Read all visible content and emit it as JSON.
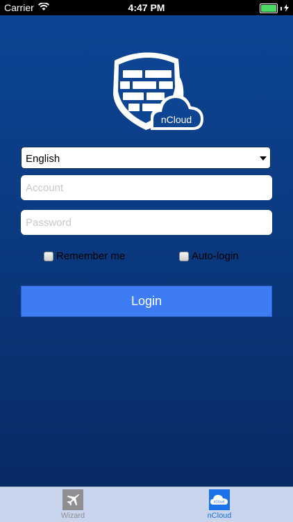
{
  "status": {
    "carrier": "Carrier",
    "time": "4:47 PM"
  },
  "logo": {
    "text": "nCloud"
  },
  "form": {
    "language": "English",
    "account_placeholder": "Account",
    "password_placeholder": "Password",
    "remember_label": "Remember me",
    "autologin_label": "Auto-login",
    "login_label": "Login"
  },
  "tabs": [
    {
      "label": "Wizard",
      "icon": "airplane-icon"
    },
    {
      "label": "nCloud",
      "icon": "ncloud-icon",
      "icon_text": "nCloud"
    }
  ],
  "colors": {
    "accent": "#3d7cf2",
    "active_tab": "#1a73e8",
    "battery": "#4cd964"
  }
}
